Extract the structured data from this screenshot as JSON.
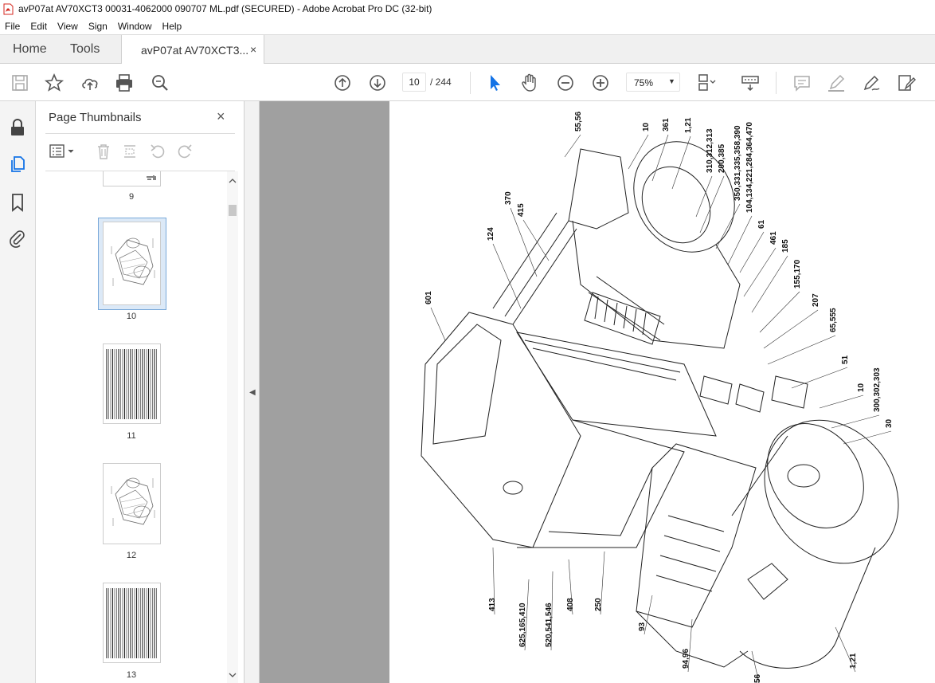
{
  "window": {
    "title": "avP07at AV70XCT3 00031-4062000 090707 ML.pdf (SECURED) - Adobe Acrobat Pro DC (32-bit)"
  },
  "menu": [
    "File",
    "Edit",
    "View",
    "Sign",
    "Window",
    "Help"
  ],
  "tabs": {
    "home": "Home",
    "tools": "Tools",
    "document": "avP07at AV70XCT3...",
    "close": "×"
  },
  "toolbar": {
    "current_page": "10",
    "total_pages": "/ 244",
    "zoom": "75%"
  },
  "panel": {
    "title": "Page Thumbnails",
    "close": "×",
    "thumbnails": [
      {
        "label": "9"
      },
      {
        "label": "10"
      },
      {
        "label": "11"
      },
      {
        "label": "12"
      },
      {
        "label": "13"
      }
    ]
  },
  "drawing": {
    "callouts": [
      "55,56",
      "10",
      "361",
      "1,21",
      "310,312,313",
      "200,385",
      "350,331,335,358,390",
      "104,134,221,284,364,470",
      "61",
      "461",
      "185",
      "155,170",
      "207",
      "65,555",
      "51",
      "10",
      "300,302,303",
      "30",
      "415",
      "370",
      "124",
      "601",
      "413",
      "625,165,410",
      "520,541,546",
      "408",
      "250",
      "93",
      "94,96",
      "56",
      "1,21"
    ]
  }
}
